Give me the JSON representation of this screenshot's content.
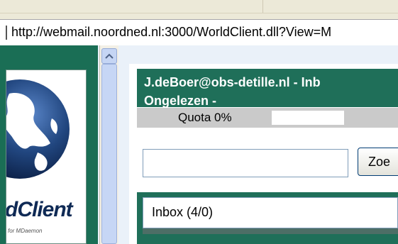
{
  "browser": {
    "address_url": "http://webmail.noordned.nl:3000/WorldClient.dll?View=M"
  },
  "logo": {
    "wordmark": "dClient",
    "tagline": "for MDaemon"
  },
  "header": {
    "account_line": "J.deBoer@obs-detille.nl - Inb",
    "status_line": "Ongelezen -"
  },
  "quota": {
    "text": "Quota 0%",
    "percent": 0
  },
  "search": {
    "value": "",
    "button_label": "Zoe"
  },
  "folder": {
    "selected": "Inbox (4/0)"
  },
  "colors": {
    "theme_green": "#1f6f59",
    "scrollbar_blue": "#c6d6f5"
  },
  "icons": [
    "globe-logo-icon",
    "scroll-up-arrow-icon"
  ]
}
